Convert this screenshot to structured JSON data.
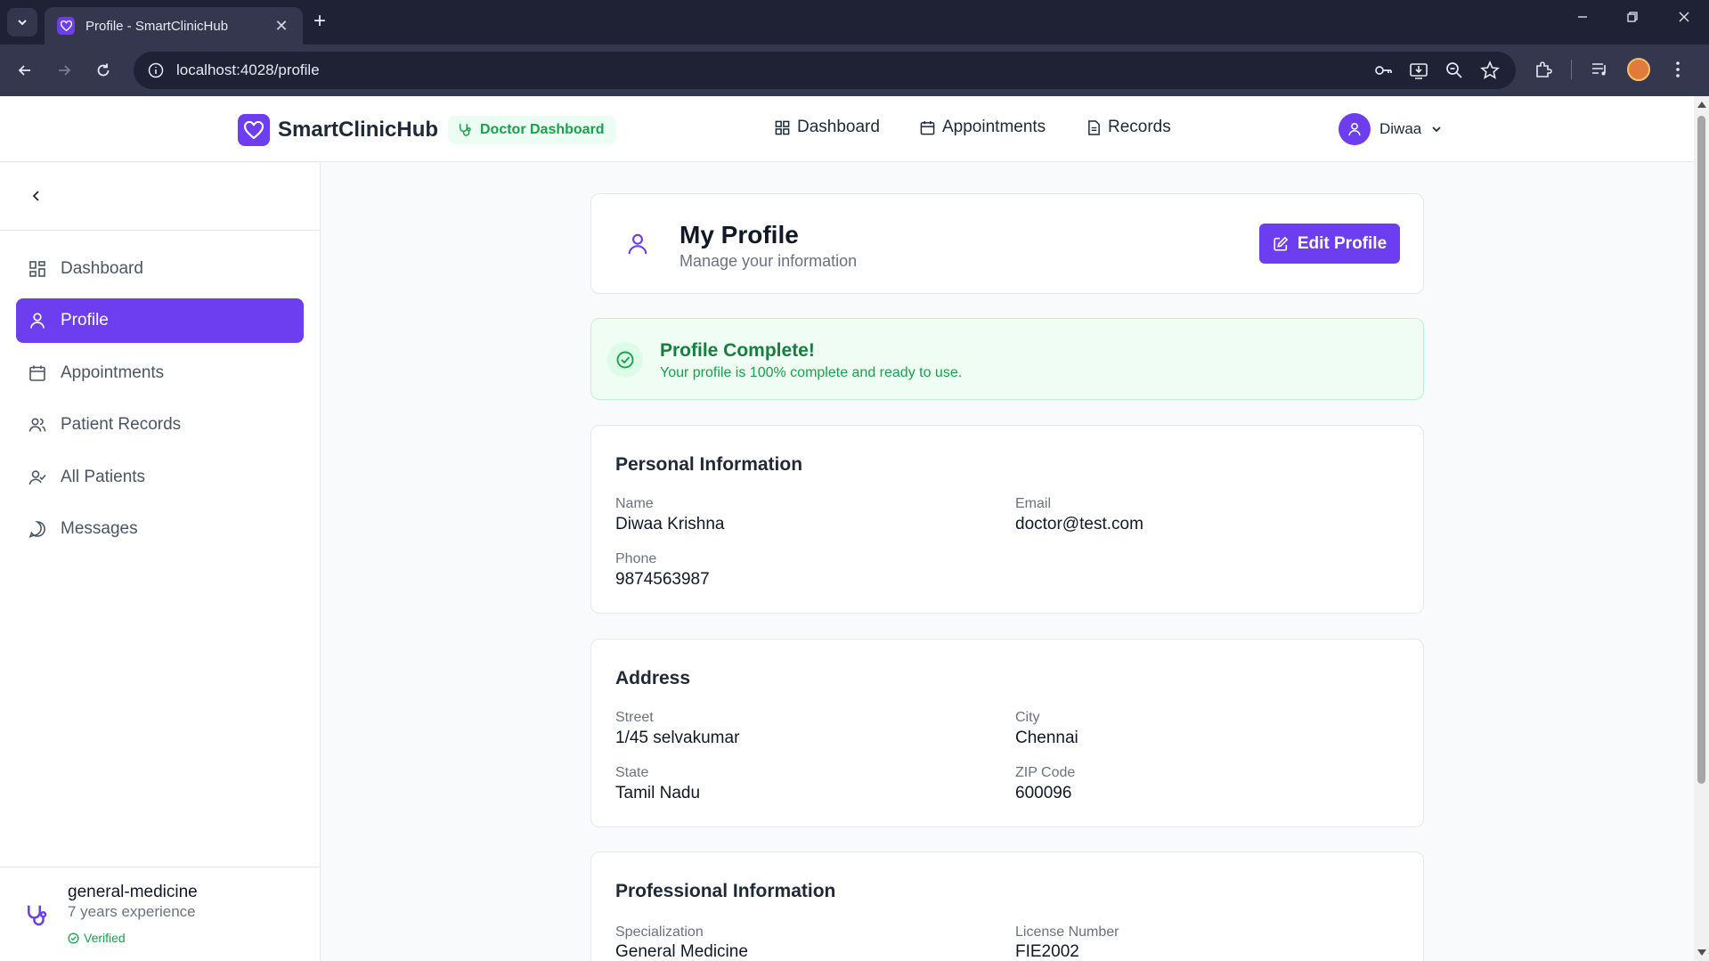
{
  "browser": {
    "tab_title": "Profile - SmartClinicHub",
    "url": "localhost:4028/profile",
    "new_tab": "+",
    "tab_close": "✕"
  },
  "header": {
    "brand": "SmartClinicHub",
    "role_badge": "Doctor Dashboard",
    "nav": [
      "Dashboard",
      "Appointments",
      "Records"
    ],
    "user_name": "Diwaa",
    "accent_color": "#6d3ef0"
  },
  "sidebar": {
    "items": [
      {
        "label": "Dashboard",
        "icon": "grid-icon"
      },
      {
        "label": "Profile",
        "icon": "user-icon",
        "active": true
      },
      {
        "label": "Appointments",
        "icon": "calendar-icon"
      },
      {
        "label": "Patient Records",
        "icon": "users-icon"
      },
      {
        "label": "All Patients",
        "icon": "user-check-icon"
      },
      {
        "label": "Messages",
        "icon": "message-icon"
      }
    ],
    "footer": {
      "specialty": "general-medicine",
      "experience": "7 years experience",
      "verified": "Verified"
    }
  },
  "main": {
    "title": "My Profile",
    "subtitle": "Manage your information",
    "edit_button": "Edit Profile",
    "complete": {
      "title": "Profile Complete!",
      "message": "Your profile is 100% complete and ready to use."
    },
    "personal": {
      "heading": "Personal Information",
      "name_label": "Name",
      "name": "Diwaa Krishna",
      "email_label": "Email",
      "email": "doctor@test.com",
      "phone_label": "Phone",
      "phone": "9874563987"
    },
    "address": {
      "heading": "Address",
      "street_label": "Street",
      "street": "1/45 selvakumar",
      "city_label": "City",
      "city": "Chennai",
      "state_label": "State",
      "state": "Tamil Nadu",
      "zip_label": "ZIP Code",
      "zip": "600096"
    },
    "professional": {
      "heading": "Professional Information",
      "specialization_label": "Specialization",
      "specialization": "General Medicine",
      "license_label": "License Number",
      "license": "FIE2002"
    }
  }
}
